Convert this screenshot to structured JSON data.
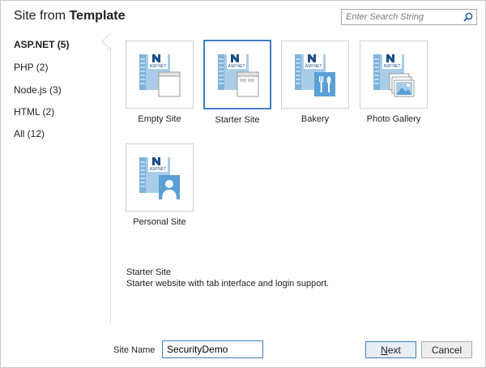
{
  "dialog": {
    "title_prefix": "Site from",
    "title_bold": "Template"
  },
  "search": {
    "placeholder": "Enter Search String"
  },
  "categories": [
    {
      "label": "ASP.NET (5)",
      "selected": true
    },
    {
      "label": "PHP (2)"
    },
    {
      "label": "Node.js (3)"
    },
    {
      "label": "HTML (2)"
    },
    {
      "label": "All (12)"
    }
  ],
  "templates": [
    {
      "label": "Empty Site",
      "icon": "empty-site-icon"
    },
    {
      "label": "Starter Site",
      "icon": "starter-site-icon",
      "selected": true
    },
    {
      "label": "Bakery",
      "icon": "bakery-icon"
    },
    {
      "label": "Photo Gallery",
      "icon": "photo-gallery-icon"
    },
    {
      "label": "Personal Site",
      "icon": "personal-site-icon"
    }
  ],
  "description": {
    "title": "Starter Site",
    "text": "Starter website with tab interface and login support."
  },
  "footer": {
    "site_name_label": "Site Name",
    "site_name_value": "SecurityDemo",
    "next_label": "Next",
    "cancel_label": "Cancel"
  },
  "colors": {
    "accent": "#3d7fc2",
    "page_blue": "#a9cde8",
    "badge_blue": "#5a9fd6"
  }
}
